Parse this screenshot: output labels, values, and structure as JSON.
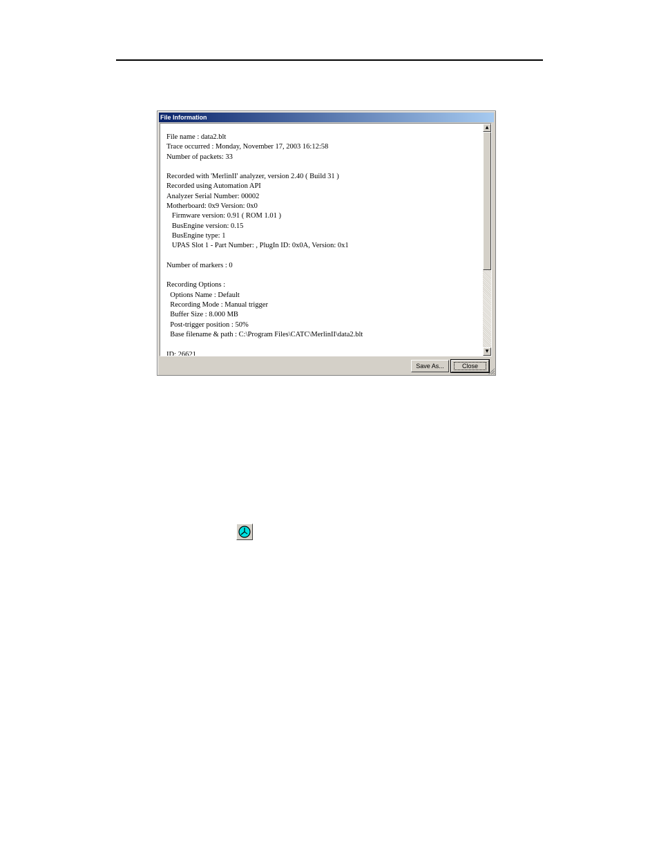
{
  "dialog": {
    "title": "File Information",
    "lines": [
      "File name : data2.blt",
      "Trace occurred : Monday, November 17, 2003 16:12:58",
      "Number of packets: 33",
      "",
      "Recorded with 'MerlinII' analyzer, version 2.40 ( Build 31 )",
      "Recorded using Automation API",
      "Analyzer Serial Number: 00002",
      "Motherboard: 0x9 Version: 0x0",
      "   Firmware version: 0.91 ( ROM 1.01 )",
      "   BusEngine version: 0.15",
      "   BusEngine type: 1",
      "   UPAS Slot 1 - Part Number: , PlugIn ID: 0x0A, Version: 0x1",
      "",
      "Number of markers : 0",
      "",
      "Recording Options :",
      "  Options Name : Default",
      "  Recording Mode : Manual trigger",
      "  Buffer Size : 8.000 MB",
      "  Post-trigger position : 50%",
      "  Base filename & path : C:\\Program Files\\CATC\\MerlinII\\data2.blt",
      "",
      "ID: 26621"
    ],
    "buttons": {
      "save_as": "Save As...",
      "close": "Close"
    }
  },
  "icons": {
    "scroll_up": "scroll-up-arrow-icon",
    "scroll_down": "scroll-down-arrow-icon",
    "clock": "clock-icon"
  },
  "colors": {
    "titlebar_start": "#0a246a",
    "titlebar_end": "#a6caf0",
    "dialog_face": "#d4d0c8",
    "clock_face": "#00e0e0"
  }
}
